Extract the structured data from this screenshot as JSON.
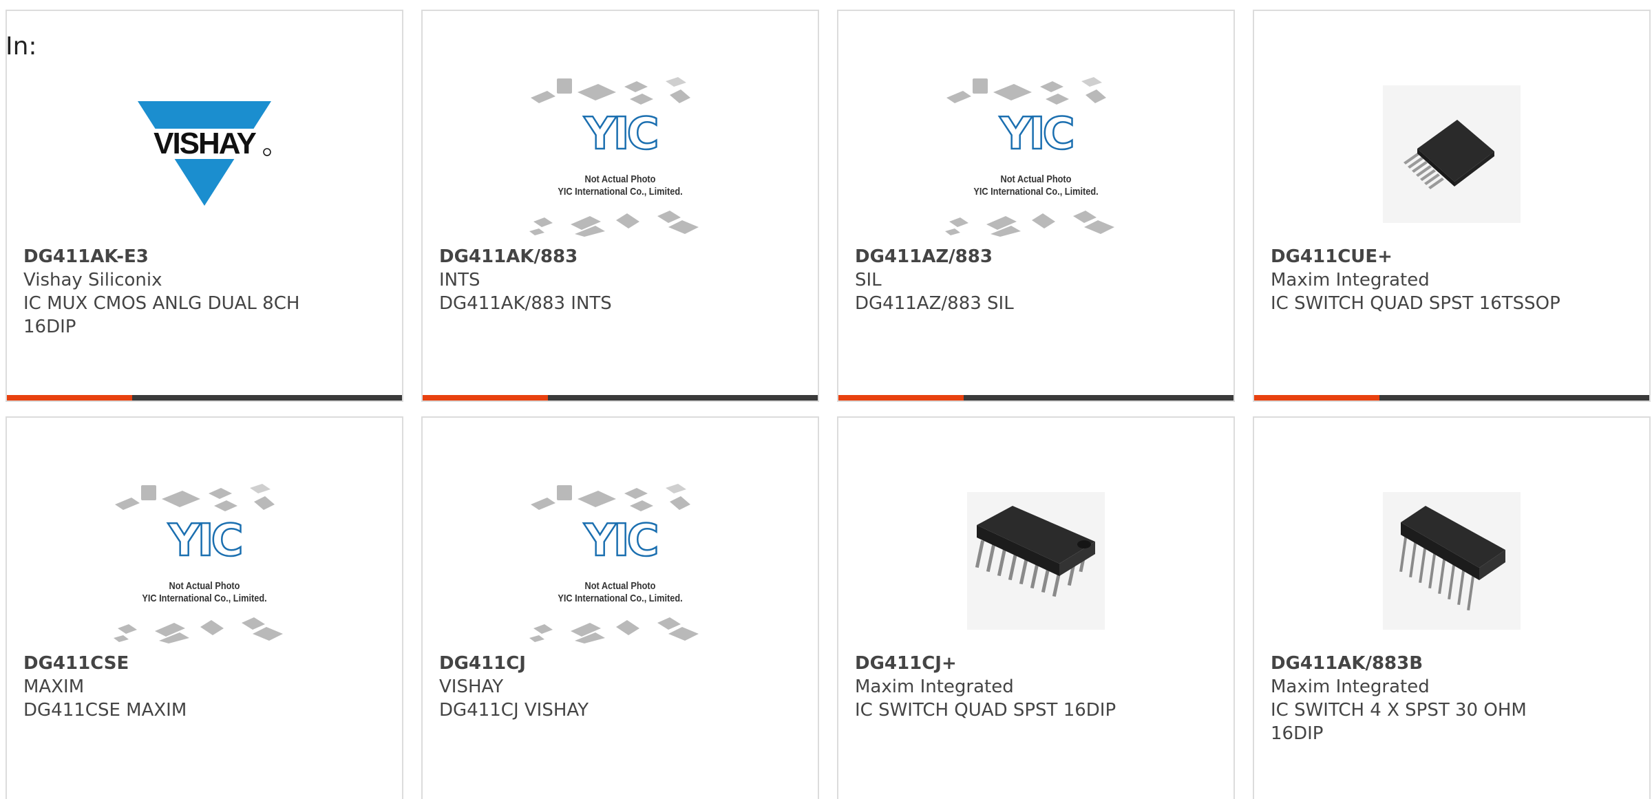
{
  "filter_label": "In:",
  "colors": {
    "accent": "#e8410f",
    "bar": "#3a3a3a",
    "border": "#dcdcdc",
    "vishay_blue": "#1b8ecf"
  },
  "placeholder": {
    "line1": "Not Actual Photo",
    "line2": "YIC International Co., Limited.",
    "logo_text": "YIC"
  },
  "vishay_logo_text": "VISHAY",
  "products": [
    {
      "part": "DG411AK-E3",
      "manufacturer": "Vishay Siliconix",
      "description": "IC MUX CMOS ANLG DUAL 8CH 16DIP",
      "image": "vishay-logo"
    },
    {
      "part": "DG411AK/883",
      "manufacturer": "INTS",
      "description": "DG411AK/883 INTS",
      "image": "placeholder"
    },
    {
      "part": "DG411AZ/883",
      "manufacturer": "SIL",
      "description": "DG411AZ/883 SIL",
      "image": "placeholder"
    },
    {
      "part": "DG411CUE+",
      "manufacturer": "Maxim Integrated",
      "description": "IC SWITCH QUAD SPST 16TSSOP",
      "image": "tssop-chip"
    },
    {
      "part": "DG411CSE",
      "manufacturer": "MAXIM",
      "description": "DG411CSE MAXIM",
      "image": "placeholder"
    },
    {
      "part": "DG411CJ",
      "manufacturer": "VISHAY",
      "description": "DG411CJ VISHAY",
      "image": "placeholder"
    },
    {
      "part": "DG411CJ+",
      "manufacturer": "Maxim Integrated",
      "description": "IC SWITCH QUAD SPST 16DIP",
      "image": "dip-chip"
    },
    {
      "part": "DG411AK/883B",
      "manufacturer": "Maxim Integrated",
      "description": "IC SWITCH 4 X SPST 30 OHM 16DIP",
      "image": "dip-chip-alt"
    }
  ]
}
